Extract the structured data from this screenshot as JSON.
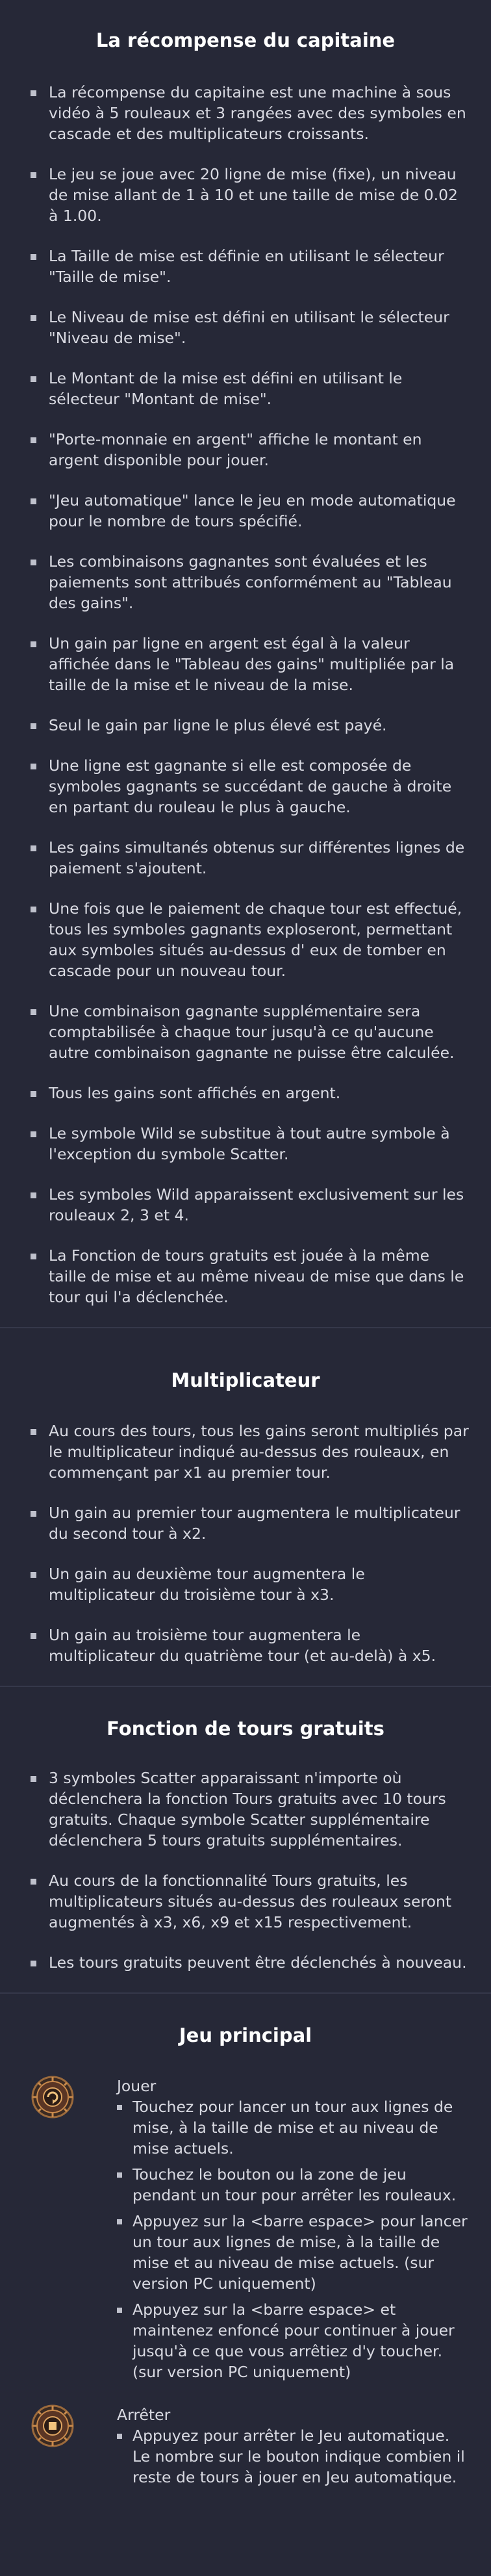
{
  "sections": {
    "captain": {
      "title": "La récompense du capitaine",
      "items": [
        "La récompense du capitaine est une machine à sous vidéo à 5 rouleaux et 3 rangées avec des symboles en cascade et des multiplicateurs croissants.",
        "Le jeu se joue avec 20 ligne de mise (fixe), un niveau de mise allant de 1 à 10 et une taille de mise de 0.02 à 1.00.",
        "La Taille de mise est définie en utilisant le sélecteur \"Taille de mise\".",
        "Le Niveau de mise est défini en utilisant le sélecteur \"Niveau de mise\".",
        "Le Montant de la mise est défini en utilisant le sélecteur \"Montant de mise\".",
        "\"Porte-monnaie en argent\" affiche le montant en argent disponible pour jouer.",
        "\"Jeu automatique\" lance le jeu en mode automatique pour le nombre de tours spécifié.",
        "Les combinaisons gagnantes sont évaluées et les paiements sont attribués conformément au \"Tableau des gains\".",
        "Un gain par ligne en argent est égal à la valeur affichée dans le \"Tableau des gains\" multipliée par la taille de la mise et le niveau de la mise.",
        "Seul le gain par ligne le plus élevé est payé.",
        "Une ligne est gagnante si elle est composée de symboles gagnants se succédant de gauche à droite en partant du rouleau le plus à gauche.",
        "Les gains simultanés obtenus sur différentes lignes de paiement s'ajoutent.",
        "Une fois que le paiement de chaque tour est effectué, tous les symboles gagnants exploseront, permettant aux symboles situés au-dessus d'  eux de tomber en cascade pour un nouveau tour.",
        "Une combinaison gagnante supplémentaire sera comptabilisée à chaque tour jusqu'à ce qu'aucune autre combinaison gagnante ne puisse être calculée.",
        "Tous les gains sont affichés en argent.",
        "Le symbole Wild se substitue à tout autre symbole à l'exception du symbole Scatter.",
        "Les symboles Wild apparaissent exclusivement sur les rouleaux 2, 3 et 4.",
        "La Fonction de tours gratuits est jouée à la même taille de mise et au même niveau de mise que dans le tour qui l'a déclenchée."
      ]
    },
    "multiplier": {
      "title": "Multiplicateur",
      "items": [
        "Au cours des tours, tous les gains seront multipliés par le multiplicateur indiqué au-dessus des rouleaux, en commençant par x1 au premier tour.",
        "Un gain au premier tour augmentera le multiplicateur du second tour à x2.",
        "Un gain au deuxième tour augmentera le multiplicateur du troisième tour à x3.",
        "Un gain au troisième tour augmentera le multiplicateur du quatrième tour (et au-delà) à x5."
      ]
    },
    "freespins": {
      "title": "Fonction de tours gratuits",
      "items": [
        "3 symboles Scatter apparaissant n'importe où déclenchera la fonction Tours gratuits avec 10 tours gratuits. Chaque symbole Scatter supplémentaire déclenchera 5 tours gratuits supplémentaires.",
        "Au cours de la fonctionnalité Tours gratuits, les multiplicateurs situés au-dessus des rouleaux seront augmentés à x3, x6, x9 et x15 respectivement.",
        "Les tours gratuits peuvent être déclenchés à nouveau."
      ]
    },
    "main": {
      "title": "Jeu principal",
      "features": [
        {
          "name": "Jouer",
          "icon": "spin-button-icon",
          "items": [
            "Touchez pour lancer un tour aux lignes de mise, à la taille de mise et au niveau de mise actuels.",
            "Touchez le bouton ou la zone de jeu pendant un tour pour arrêter les rouleaux.",
            "Appuyez sur la <barre espace> pour lancer un tour aux lignes de mise, à la taille de mise et au niveau de mise actuels. (sur version PC uniquement)",
            "Appuyez sur la <barre espace> et maintenez enfoncé pour continuer à jouer jusqu'à ce que vous arrêtiez d'y toucher. (sur version PC uniquement)"
          ]
        },
        {
          "name": "Arrêter",
          "icon": "stop-button-icon",
          "items": [
            "Appuyez pour arrêter le Jeu automatique. Le nombre sur le bouton indique combien il reste de tours à jouer en Jeu automatique."
          ]
        }
      ]
    }
  }
}
